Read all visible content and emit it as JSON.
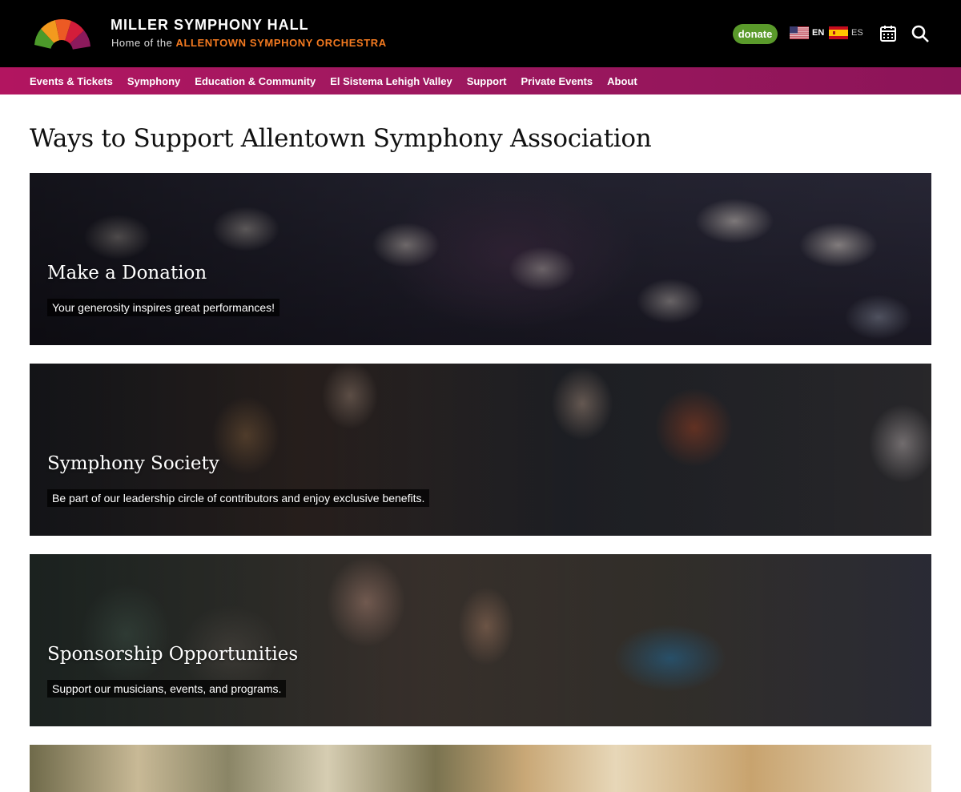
{
  "header": {
    "title": "MILLER SYMPHONY HALL",
    "subtitle_prefix": "Home of the",
    "subtitle_highlight": "ALLENTOWN SYMPHONY ORCHESTRA",
    "donate_label": "donate",
    "languages": [
      {
        "code": "EN",
        "flag": "us-flag-icon",
        "active": true
      },
      {
        "code": "ES",
        "flag": "spain-flag-icon",
        "active": false
      }
    ],
    "icons": [
      "calendar-icon",
      "search-icon"
    ],
    "colors": {
      "accent_orange": "#f47a20",
      "donate_green": "#5a9a2b",
      "nav_magenta": "#a01860"
    }
  },
  "nav": {
    "items": [
      {
        "label": "Events & Tickets"
      },
      {
        "label": "Symphony"
      },
      {
        "label": "Education & Community"
      },
      {
        "label": "El Sistema Lehigh Valley"
      },
      {
        "label": "Support"
      },
      {
        "label": "Private Events"
      },
      {
        "label": "About"
      }
    ]
  },
  "main": {
    "page_title": "Ways to Support Allentown Symphony Association",
    "cards": [
      {
        "title": "Make a Donation",
        "description": "Your generosity inspires great performances!"
      },
      {
        "title": "Symphony Society",
        "description": "Be part of our leadership circle of contributors and enjoy exclusive benefits."
      },
      {
        "title": "Sponsorship Opportunities",
        "description": "Support our musicians, events, and programs."
      },
      {
        "title": "",
        "description": ""
      }
    ]
  }
}
